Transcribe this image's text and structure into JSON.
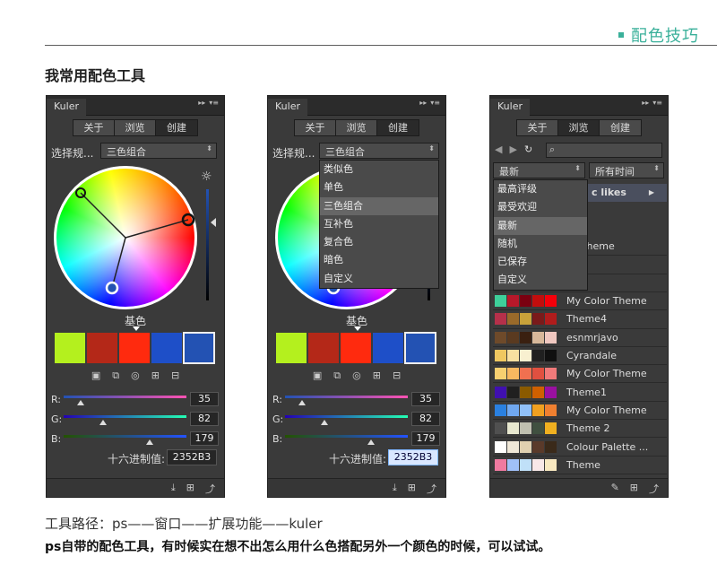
{
  "header": {
    "brand": "配色技巧"
  },
  "section_title": "我常用配色工具",
  "panel_common": {
    "tab": "Kuler",
    "tab_controls": [
      "▸▸",
      "▾≡"
    ],
    "buttons": [
      "关于",
      "浏览",
      "创建"
    ]
  },
  "panel1": {
    "rule_label": "选择规...",
    "rule_value": "三色组合",
    "base_label": "基色",
    "swatches": [
      "#b4f01e",
      "#b42818",
      "#ff2a0e",
      "#1e4fc8",
      "#2352b3"
    ],
    "sliders": [
      {
        "label": "R:",
        "value": "35",
        "fraction": 0.137
      },
      {
        "label": "G:",
        "value": "82",
        "fraction": 0.322
      },
      {
        "label": "B:",
        "value": "179",
        "fraction": 0.702
      }
    ],
    "hex_label": "十六进制值:",
    "hex_value": "2352B3"
  },
  "panel2": {
    "rule_label": "选择规...",
    "rule_value": "三色组合",
    "dropdown": [
      "类似色",
      "单色",
      "三色组合",
      "互补色",
      "复合色",
      "暗色",
      "自定义"
    ],
    "dropdown_selected": "三色组合",
    "base_label": "基色",
    "swatches": [
      "#b4f01e",
      "#b42818",
      "#ff2a0e",
      "#1e4fc8",
      "#2352b3"
    ],
    "sliders": [
      {
        "label": "R:",
        "value": "35",
        "fraction": 0.137
      },
      {
        "label": "G:",
        "value": "82",
        "fraction": 0.322
      },
      {
        "label": "B:",
        "value": "179",
        "fraction": 0.702
      }
    ],
    "hex_label": "十六进制值:",
    "hex_value": "2352B3"
  },
  "panel3": {
    "filter_value": "最新",
    "time_value": "所有时间",
    "likes_label": "c likes",
    "dropdown": [
      "最高评级",
      "最受欢迎",
      "最新",
      "随机",
      "已保存",
      "自定义"
    ],
    "dropdown_selected": "最新",
    "partial_rows": [
      "lor Theme",
      "e 1",
      "e 1"
    ],
    "themes": [
      {
        "name": "My Color Theme",
        "colors": [
          "#3ecf9a",
          "#b8182a",
          "#7a0010",
          "#c20d0d",
          "#f5000a"
        ]
      },
      {
        "name": "Theme4",
        "colors": [
          "#b5304a",
          "#9a6a2a",
          "#c9a23a",
          "#7a1a1a",
          "#b01c1c"
        ]
      },
      {
        "name": "esnmrjavo",
        "colors": [
          "#6e4a2a",
          "#5a3a20",
          "#3a2010",
          "#d8b89a",
          "#f0c8c0"
        ]
      },
      {
        "name": "Cyrandale",
        "colors": [
          "#f0c860",
          "#f8e0a0",
          "#f8f0d0",
          "#202020",
          "#101010"
        ]
      },
      {
        "name": "My Color Theme",
        "colors": [
          "#f8d070",
          "#f8b860",
          "#f07050",
          "#e05040",
          "#f07a7a"
        ]
      },
      {
        "name": "Theme1",
        "colors": [
          "#4010b0",
          "#202020",
          "#8a5a00",
          "#d06000",
          "#9a10a0"
        ]
      },
      {
        "name": "My Color Theme",
        "colors": [
          "#2a80e0",
          "#70a8f0",
          "#90c0f8",
          "#f0a020",
          "#f08030"
        ]
      },
      {
        "name": "Theme 2",
        "colors": [
          "#505050",
          "#e8e8d0",
          "#c0c0b0",
          "#405040",
          "#f0b020"
        ]
      },
      {
        "name": "Colour Palette ...",
        "colors": [
          "#ffffff",
          "#f0e8d8",
          "#e0d0b0",
          "#5a3a2a",
          "#3a2a1a"
        ]
      },
      {
        "name": "Theme",
        "colors": [
          "#f07aa0",
          "#a0c0f8",
          "#c0e0f8",
          "#f8e8e8",
          "#f8e8c0"
        ]
      }
    ]
  },
  "captions": {
    "line1": "工具路径：ps——窗口——扩展功能——kuler",
    "line2": "ps自带的配色工具，有时候实在想不出怎么用什么色搭配另外一个颜色的时候，可以试试。"
  }
}
